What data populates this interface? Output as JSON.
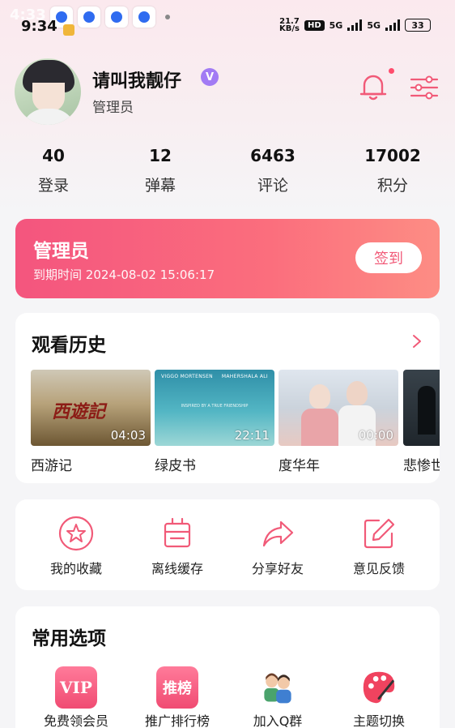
{
  "status_bar": {
    "time": "9:34",
    "time_ghost": "4:33",
    "net_speed": "21.7",
    "net_speed_unit": "KB/s",
    "hd": "HD",
    "signal_1": "5G",
    "signal_2": "5G",
    "battery": "33"
  },
  "profile": {
    "username": "请叫我靓仔",
    "verified_badge": "V",
    "role": "管理员"
  },
  "stats": [
    {
      "value": "40",
      "label": "登录"
    },
    {
      "value": "12",
      "label": "弹幕"
    },
    {
      "value": "6463",
      "label": "评论"
    },
    {
      "value": "17002",
      "label": "积分"
    }
  ],
  "vip_card": {
    "title": "管理员",
    "expire_label": "到期时间",
    "expire_time": "2024-08-02 15:06:17",
    "signin_label": "签到"
  },
  "history": {
    "title": "观看历史",
    "items": [
      {
        "title": "西游记",
        "duration": "04:03",
        "logo": "西遊記"
      },
      {
        "title": "绿皮书",
        "duration": "22:11",
        "credit_left": "VIGGO MORTENSEN",
        "credit_right": "MAHERSHALA ALI",
        "tagline": "INSPIRED BY A TRUE FRIENDSHIP"
      },
      {
        "title": "度华年",
        "duration": "00:00"
      },
      {
        "title": "悲惨世界",
        "duration": ""
      }
    ]
  },
  "actions": [
    {
      "label": "我的收藏",
      "icon": "star-icon"
    },
    {
      "label": "离线缓存",
      "icon": "download-box-icon"
    },
    {
      "label": "分享好友",
      "icon": "share-icon"
    },
    {
      "label": "意见反馈",
      "icon": "edit-icon"
    }
  ],
  "options": {
    "title": "常用选项",
    "items": [
      {
        "label": "免费领会员",
        "icon_text": "VIP",
        "icon": "vip-icon"
      },
      {
        "label": "推广排行榜",
        "icon_text": "推榜",
        "icon": "ranking-icon"
      },
      {
        "label": "加入Q群",
        "icon": "group-icon"
      },
      {
        "label": "主题切换",
        "icon": "palette-icon"
      }
    ]
  },
  "colors": {
    "accent": "#f15a78",
    "card_gradient_start": "#f4557e",
    "card_gradient_end": "#fd8d84"
  }
}
